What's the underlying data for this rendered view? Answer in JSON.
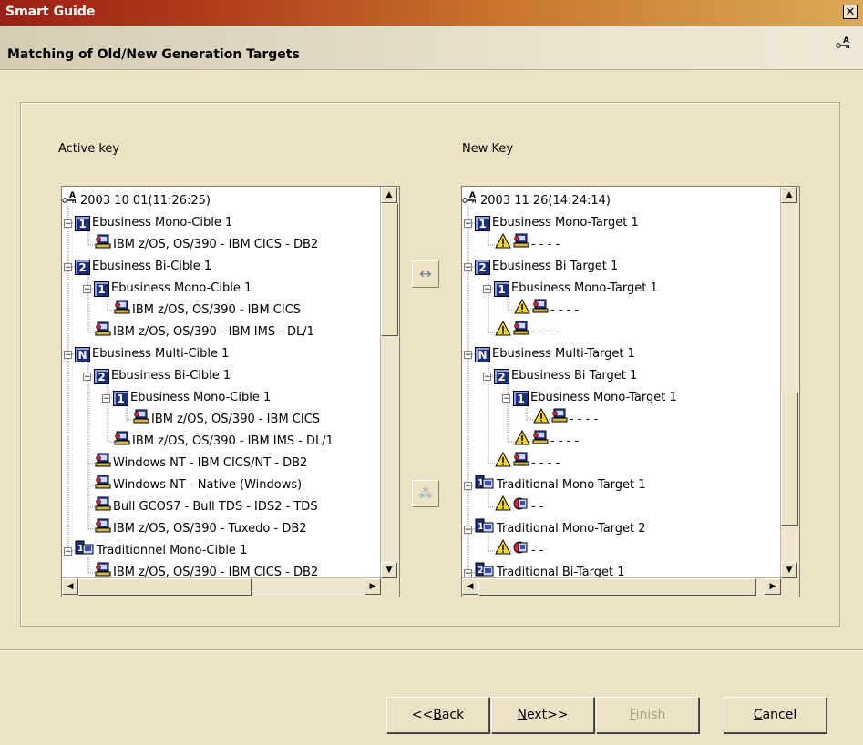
{
  "window": {
    "title": "Smart Guide",
    "close_glyph": "✕"
  },
  "header": {
    "title": "Matching of Old/New Generation Targets",
    "icon": "key-icon"
  },
  "labels": {
    "active": "Active key",
    "new": "New Key"
  },
  "left_tree": {
    "rows": [
      {
        "indent": 0,
        "exp": "",
        "icon": "key-icon",
        "text": "2003 10 01(11:26:25)"
      },
      {
        "indent": 1,
        "exp": "−",
        "icon": "num-1",
        "num": "1",
        "text": "Ebusiness Mono-Cible 1"
      },
      {
        "indent": 2,
        "exp": "",
        "icon": "computer-icon",
        "text": "IBM z/OS, OS/390 - IBM CICS - DB2"
      },
      {
        "indent": 1,
        "exp": "−",
        "icon": "num-2",
        "num": "2",
        "text": "Ebusiness Bi-Cible 1"
      },
      {
        "indent": 2,
        "exp": "−",
        "icon": "num-1",
        "num": "1",
        "text": "Ebusiness Mono-Cible 1"
      },
      {
        "indent": 3,
        "exp": "",
        "icon": "computer-icon",
        "text": "IBM z/OS, OS/390 - IBM CICS"
      },
      {
        "indent": 2,
        "exp": "",
        "icon": "computer-icon",
        "text": "IBM z/OS, OS/390 - IBM IMS - DL/1"
      },
      {
        "indent": 1,
        "exp": "−",
        "icon": "num-n",
        "num": "N",
        "text": "Ebusiness Multi-Cible 1"
      },
      {
        "indent": 2,
        "exp": "−",
        "icon": "num-2",
        "num": "2",
        "text": "Ebusiness Bi-Cible 1"
      },
      {
        "indent": 3,
        "exp": "−",
        "icon": "num-1",
        "num": "1",
        "text": "Ebusiness Mono-Cible 1"
      },
      {
        "indent": 4,
        "exp": "",
        "icon": "computer-icon",
        "text": "IBM z/OS, OS/390 - IBM CICS"
      },
      {
        "indent": 3,
        "exp": "",
        "icon": "computer-icon",
        "text": "IBM z/OS, OS/390 - IBM IMS - DL/1"
      },
      {
        "indent": 2,
        "exp": "",
        "icon": "computer-icon",
        "text": "Windows NT - IBM CICS/NT - DB2"
      },
      {
        "indent": 2,
        "exp": "",
        "icon": "computer-icon",
        "text": "Windows NT - Native (Windows)"
      },
      {
        "indent": 2,
        "exp": "",
        "icon": "computer-icon",
        "text": "Bull GCOS7 - Bull TDS - IDS2 - TDS"
      },
      {
        "indent": 2,
        "exp": "",
        "icon": "computer-icon",
        "text": "IBM z/OS, OS/390 - Tuxedo - DB2"
      },
      {
        "indent": 1,
        "exp": "−",
        "icon": "trad-icon",
        "text": "Traditionnel Mono-Cible 1"
      },
      {
        "indent": 2,
        "exp": "",
        "icon": "computer-icon",
        "text": "IBM z/OS, OS/390 - IBM CICS - DB2"
      }
    ]
  },
  "right_tree": {
    "rows": [
      {
        "indent": 0,
        "exp": "",
        "icon": "key-icon",
        "text": "2003 11 26(14:24:14)"
      },
      {
        "indent": 1,
        "exp": "−",
        "icon": "num-1",
        "num": "1",
        "text": "Ebusiness Mono-Target 1"
      },
      {
        "indent": 2,
        "exp": "",
        "icon": "warning-computer",
        "text": "- - - -"
      },
      {
        "indent": 1,
        "exp": "−",
        "icon": "num-2",
        "num": "2",
        "text": "Ebusiness Bi Target 1"
      },
      {
        "indent": 2,
        "exp": "−",
        "icon": "num-1",
        "num": "1",
        "text": "Ebusiness Mono-Target 1"
      },
      {
        "indent": 3,
        "exp": "",
        "icon": "warning-computer",
        "text": "- - - -"
      },
      {
        "indent": 2,
        "exp": "",
        "icon": "warning-computer",
        "text": "- - - -"
      },
      {
        "indent": 1,
        "exp": "−",
        "icon": "num-n",
        "num": "N",
        "text": "Ebusiness Multi-Target 1"
      },
      {
        "indent": 2,
        "exp": "−",
        "icon": "num-2",
        "num": "2",
        "text": "Ebusiness Bi Target 1"
      },
      {
        "indent": 3,
        "exp": "−",
        "icon": "num-1",
        "num": "1",
        "text": "Ebusiness Mono-Target 1"
      },
      {
        "indent": 4,
        "exp": "",
        "icon": "warning-computer",
        "text": "- - - -"
      },
      {
        "indent": 3,
        "exp": "",
        "icon": "warning-computer",
        "text": "- - - -"
      },
      {
        "indent": 2,
        "exp": "",
        "icon": "warning-computer",
        "text": "- - - -"
      },
      {
        "indent": 1,
        "exp": "−",
        "icon": "trad-icon",
        "text": "Traditional Mono-Target 1"
      },
      {
        "indent": 2,
        "exp": "",
        "icon": "warning-trad",
        "text": "- -"
      },
      {
        "indent": 1,
        "exp": "−",
        "icon": "trad-icon",
        "text": "Traditional Mono-Target 2"
      },
      {
        "indent": 2,
        "exp": "",
        "icon": "warning-trad",
        "text": "- -"
      },
      {
        "indent": 1,
        "exp": "−",
        "icon": "trad2-icon",
        "text": "Traditional Bi-Target 1"
      }
    ]
  },
  "middle": {
    "swap_glyph": "↔",
    "link_glyph": "⁂"
  },
  "buttons": {
    "back": "<<Back",
    "next": "Next>>",
    "finish": "Finish",
    "cancel": "Cancel"
  },
  "colors": {
    "title_start": "#9a2015",
    "title_end": "#dba957",
    "panel_bg": "#ece2c5",
    "num_icon": "#1d2f7a"
  }
}
